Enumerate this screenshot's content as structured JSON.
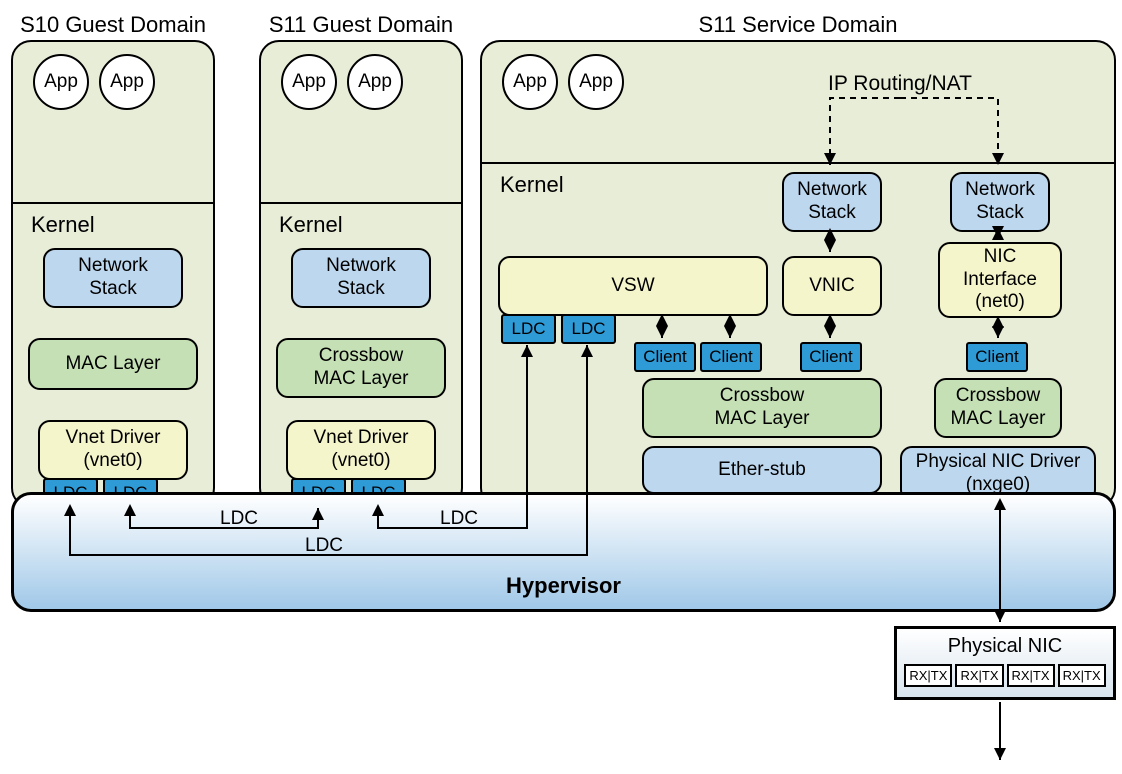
{
  "titles": {
    "s10_guest": "S10 Guest Domain",
    "s11_guest": "S11 Guest Domain",
    "s11_service": "S11 Service Domain"
  },
  "labels": {
    "app": "App",
    "kernel": "Kernel",
    "network_stack": "Network\nStack",
    "mac_layer": "MAC Layer",
    "crossbow_mac_layer": "Crossbow\nMAC Layer",
    "vnet_driver": "Vnet Driver\n(vnet0)",
    "ldc": "LDC",
    "vsw": "VSW",
    "vnic": "VNIC",
    "nic_interface": "NIC\nInterface\n(net0)",
    "client": "Client",
    "ether_stub": "Ether-stub",
    "physical_nic_driver": "Physical NIC Driver\n(nxge0)",
    "hypervisor": "Hypervisor",
    "ip_routing_nat": "IP Routing/NAT",
    "physical_nic": "Physical NIC",
    "rxtx": "RX|TX"
  },
  "ldc_connection_labels": {
    "ldc1": "LDC",
    "ldc2": "LDC",
    "ldc3": "LDC"
  }
}
